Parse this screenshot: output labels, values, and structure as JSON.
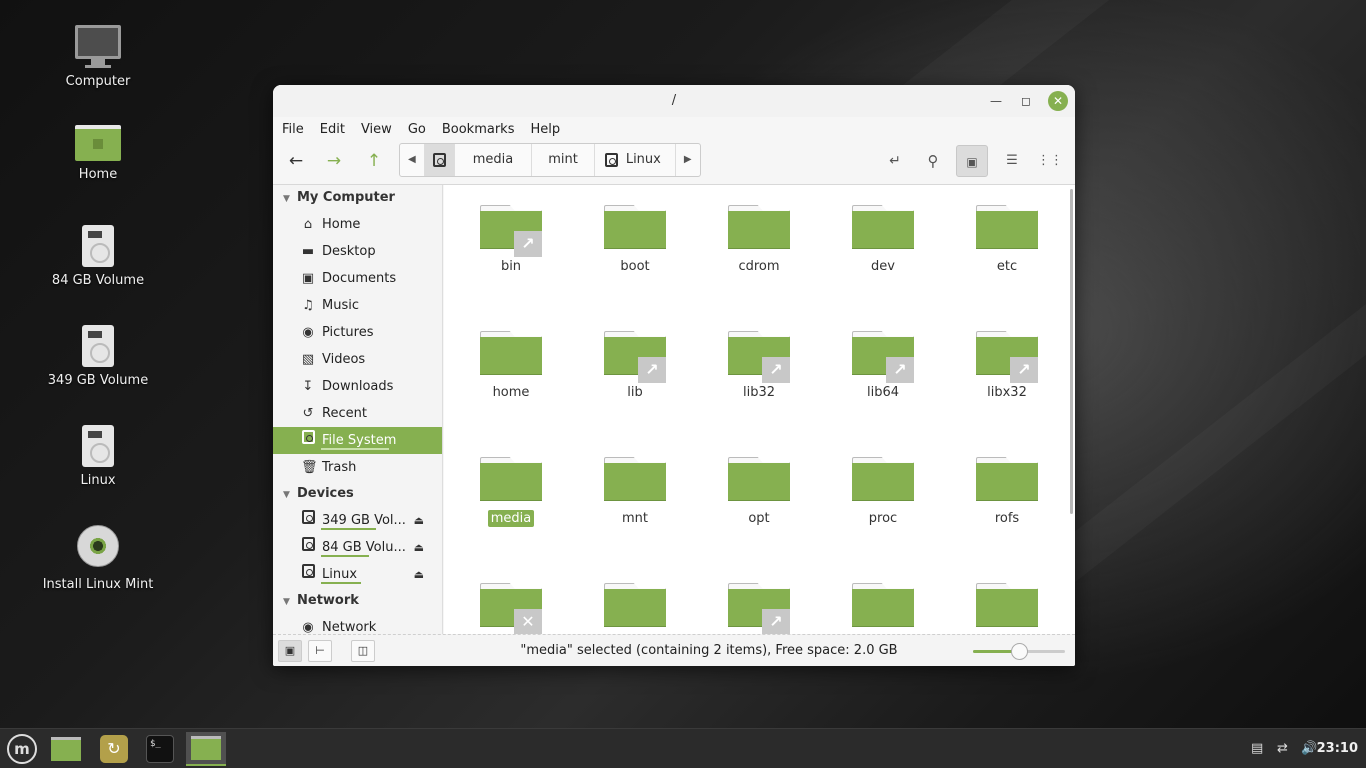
{
  "desktop": {
    "icons": [
      {
        "label": "Computer"
      },
      {
        "label": "Home"
      },
      {
        "label": "84 GB Volume"
      },
      {
        "label": "349 GB Volume"
      },
      {
        "label": "Linux"
      },
      {
        "label": "Install Linux Mint"
      }
    ]
  },
  "window": {
    "title": "/",
    "menu": [
      "File",
      "Edit",
      "View",
      "Go",
      "Bookmarks",
      "Help"
    ],
    "path": [
      "media",
      "mint",
      "Linux"
    ],
    "sidebar": {
      "sections": [
        {
          "title": "My Computer",
          "items": [
            {
              "label": "Home",
              "icon": "home-icon"
            },
            {
              "label": "Desktop",
              "icon": "desktop-icon"
            },
            {
              "label": "Documents",
              "icon": "documents-icon"
            },
            {
              "label": "Music",
              "icon": "music-icon"
            },
            {
              "label": "Pictures",
              "icon": "pictures-icon"
            },
            {
              "label": "Videos",
              "icon": "videos-icon"
            },
            {
              "label": "Downloads",
              "icon": "downloads-icon"
            },
            {
              "label": "Recent",
              "icon": "recent-icon"
            },
            {
              "label": "File System",
              "icon": "drive-icon",
              "selected": true
            },
            {
              "label": "Trash",
              "icon": "trash-icon"
            }
          ]
        },
        {
          "title": "Devices",
          "items": [
            {
              "label": "349 GB Vol...",
              "icon": "drive-icon",
              "usage": 0.6
            },
            {
              "label": "84 GB Volu...",
              "icon": "drive-icon",
              "usage": 0.55
            },
            {
              "label": "Linux",
              "icon": "drive-icon",
              "usage": 0.55
            }
          ]
        },
        {
          "title": "Network",
          "items": [
            {
              "label": "Network",
              "icon": "network-icon"
            }
          ]
        }
      ]
    },
    "files": [
      {
        "name": "bin",
        "emblem": "link"
      },
      {
        "name": "boot"
      },
      {
        "name": "cdrom"
      },
      {
        "name": "dev"
      },
      {
        "name": "etc"
      },
      {
        "name": "home"
      },
      {
        "name": "lib",
        "emblem": "link"
      },
      {
        "name": "lib32",
        "emblem": "link"
      },
      {
        "name": "lib64",
        "emblem": "link"
      },
      {
        "name": "libx32",
        "emblem": "link"
      },
      {
        "name": "media",
        "selected": true
      },
      {
        "name": "mnt"
      },
      {
        "name": "opt"
      },
      {
        "name": "proc"
      },
      {
        "name": "rofs"
      },
      {
        "name": "",
        "emblem": "noaccess"
      },
      {
        "name": ""
      },
      {
        "name": "",
        "emblem": "link"
      },
      {
        "name": ""
      },
      {
        "name": ""
      }
    ],
    "status": "\"media\" selected (containing 2 items), Free space: 2.0 GB",
    "zoom_level": 0.5
  },
  "taskbar": {
    "clock": "23:10"
  },
  "colors": {
    "accent": "#86b050"
  }
}
